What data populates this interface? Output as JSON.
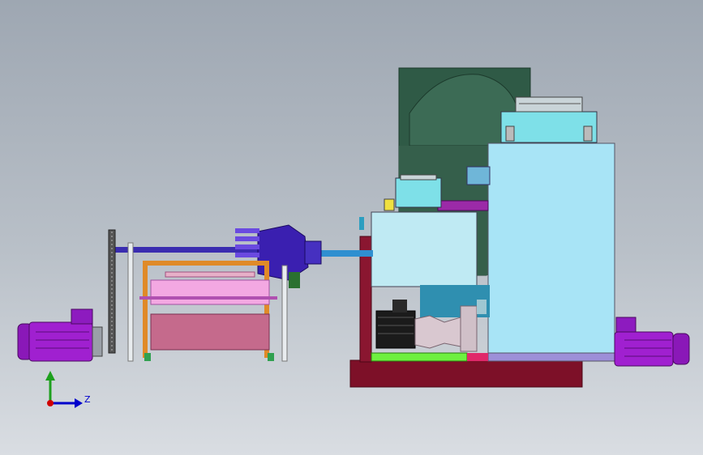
{
  "axis_triad": {
    "z_label": "Z"
  },
  "colors": {
    "motor": "#a020d0",
    "motor_dark": "#5a0d7a",
    "gearbox": "#3a1fb0",
    "tank_dark": "#2f5a46",
    "cabinet": "#a8e4f6",
    "pump_box": "#bfeaf3",
    "base_frame": "#7d1028",
    "frame_pink": "#c56a8c",
    "frame_orange": "#e08a28",
    "lime_plate": "#6ef040",
    "shaft_blue": "#2f8fd0"
  }
}
